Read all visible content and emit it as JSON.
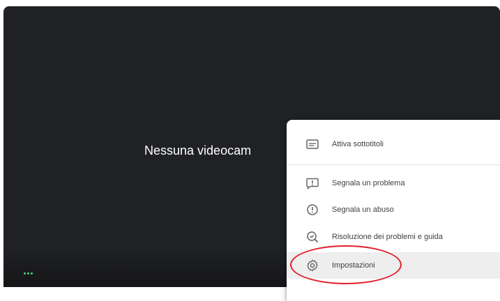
{
  "preview": {
    "no_camera_text": "Nessuna videocam"
  },
  "options_menu": {
    "items": [
      {
        "label": "Attiva sottotitoli",
        "icon": "captions-icon"
      },
      {
        "label": "Segnala un problema",
        "icon": "report-problem-icon"
      },
      {
        "label": "Segnala un abuso",
        "icon": "report-abuse-icon"
      },
      {
        "label": "Risoluzione dei problemi e guida",
        "icon": "troubleshooting-icon"
      },
      {
        "label": "Impostazioni",
        "icon": "settings-icon",
        "highlighted": true
      }
    ]
  },
  "colors": {
    "preview_background": "#202124",
    "highlight_ring": "#e01e2b",
    "more_options_dots": "#3ddc84"
  }
}
